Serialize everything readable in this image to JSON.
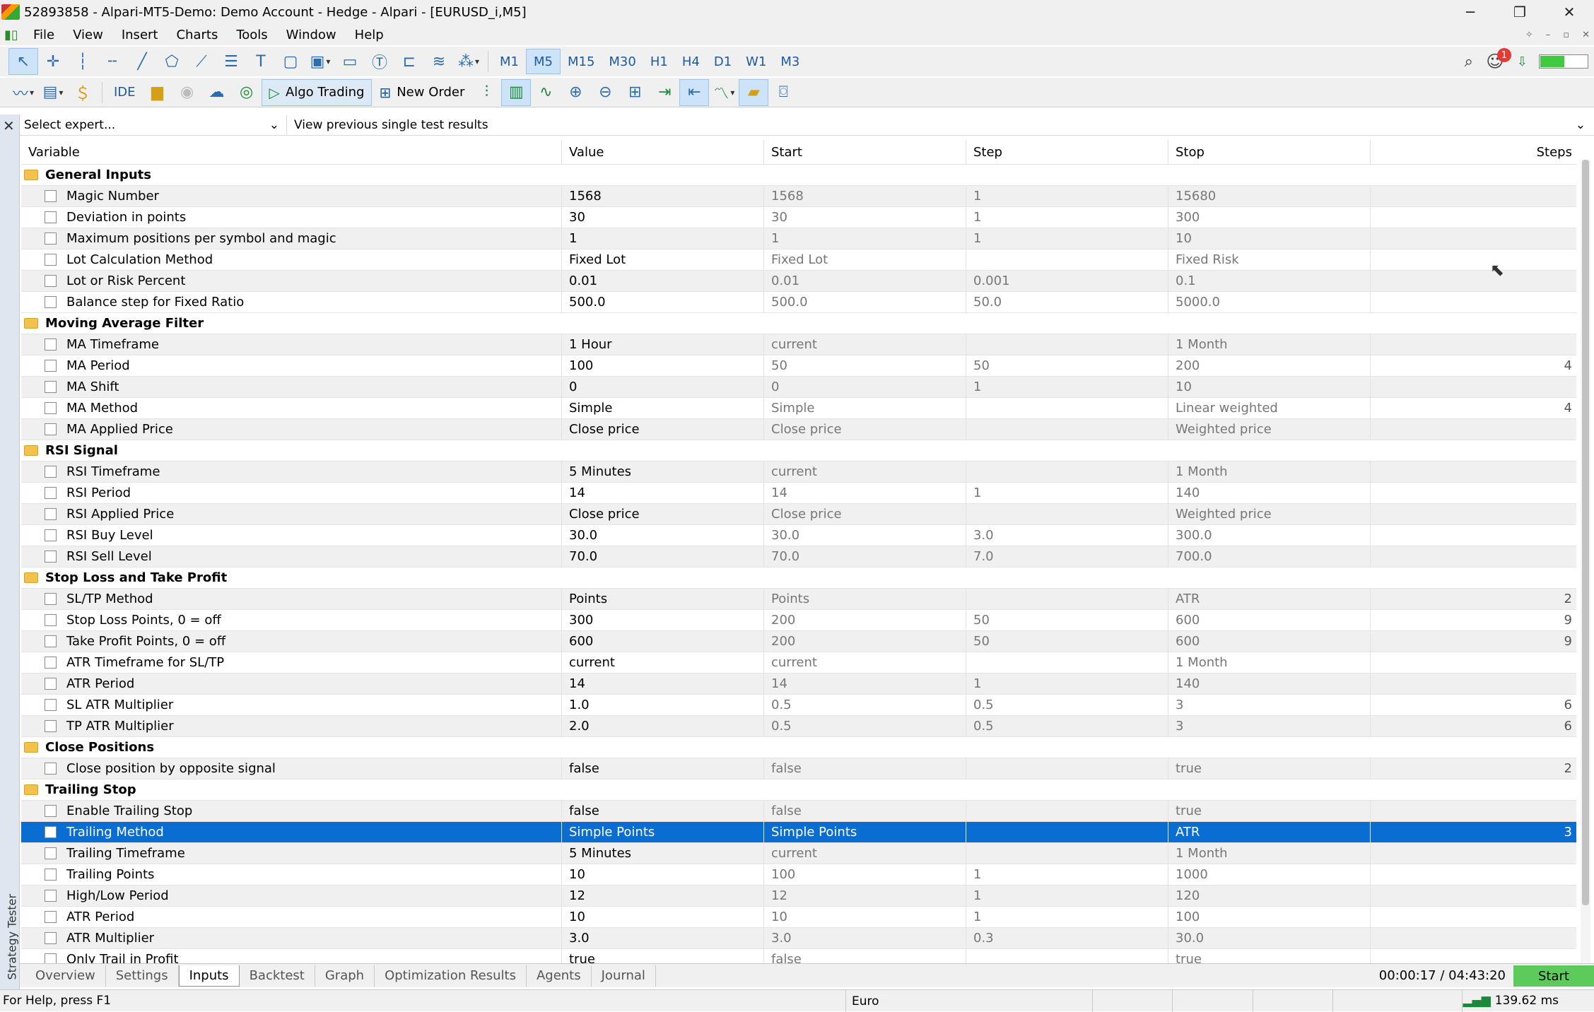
{
  "window": {
    "title": "52893858 - Alpari-MT5-Demo: Demo Account - Hedge - Alpari - [EURUSD_i,M5]"
  },
  "menu": [
    "File",
    "View",
    "Insert",
    "Charts",
    "Tools",
    "Window",
    "Help"
  ],
  "timeframes": [
    "M1",
    "M5",
    "M15",
    "M30",
    "H1",
    "H4",
    "D1",
    "W1",
    "M3"
  ],
  "timeframe_active": "M5",
  "toolbar2": {
    "ide": "IDE",
    "algo_trading": "Algo Trading",
    "new_order": "New Order"
  },
  "notifications": {
    "count": "1"
  },
  "expert": {
    "placeholder": "Select expert...",
    "view_previous": "View previous single test results"
  },
  "columns": [
    "Variable",
    "Value",
    "Start",
    "Step",
    "Stop",
    "Steps"
  ],
  "rows": [
    {
      "type": "group",
      "name": "General Inputs"
    },
    {
      "type": "param",
      "name": "Magic Number",
      "value": "1568",
      "start": "1568",
      "step": "1",
      "stop": "15680",
      "steps": ""
    },
    {
      "type": "param",
      "name": "Deviation in points",
      "value": "30",
      "start": "30",
      "step": "1",
      "stop": "300",
      "steps": ""
    },
    {
      "type": "param",
      "name": "Maximum positions per symbol and magic",
      "value": "1",
      "start": "1",
      "step": "1",
      "stop": "10",
      "steps": ""
    },
    {
      "type": "param",
      "name": "Lot Calculation Method",
      "value": "Fixed Lot",
      "start": "Fixed Lot",
      "step": "",
      "stop": "Fixed Risk",
      "steps": ""
    },
    {
      "type": "param",
      "name": "Lot or Risk Percent",
      "value": "0.01",
      "start": "0.01",
      "step": "0.001",
      "stop": "0.1",
      "steps": ""
    },
    {
      "type": "param",
      "name": "Balance step for Fixed Ratio",
      "value": "500.0",
      "start": "500.0",
      "step": "50.0",
      "stop": "5000.0",
      "steps": ""
    },
    {
      "type": "group",
      "name": "Moving Average Filter"
    },
    {
      "type": "param",
      "name": "MA Timeframe",
      "value": "1 Hour",
      "start": "current",
      "step": "",
      "stop": "1 Month",
      "steps": ""
    },
    {
      "type": "param",
      "name": "MA Period",
      "value": "100",
      "start": "50",
      "step": "50",
      "stop": "200",
      "steps": "4"
    },
    {
      "type": "param",
      "name": "MA Shift",
      "value": "0",
      "start": "0",
      "step": "1",
      "stop": "10",
      "steps": ""
    },
    {
      "type": "param",
      "name": "MA Method",
      "value": "Simple",
      "start": "Simple",
      "step": "",
      "stop": "Linear weighted",
      "steps": "4"
    },
    {
      "type": "param",
      "name": "MA Applied Price",
      "value": "Close price",
      "start": "Close price",
      "step": "",
      "stop": "Weighted price",
      "steps": ""
    },
    {
      "type": "group",
      "name": "RSI Signal"
    },
    {
      "type": "param",
      "name": "RSI Timeframe",
      "value": "5 Minutes",
      "start": "current",
      "step": "",
      "stop": "1 Month",
      "steps": ""
    },
    {
      "type": "param",
      "name": "RSI Period",
      "value": "14",
      "start": "14",
      "step": "1",
      "stop": "140",
      "steps": ""
    },
    {
      "type": "param",
      "name": "RSI Applied Price",
      "value": "Close price",
      "start": "Close price",
      "step": "",
      "stop": "Weighted price",
      "steps": ""
    },
    {
      "type": "param",
      "name": "RSI Buy Level",
      "value": "30.0",
      "start": "30.0",
      "step": "3.0",
      "stop": "300.0",
      "steps": ""
    },
    {
      "type": "param",
      "name": "RSI Sell Level",
      "value": "70.0",
      "start": "70.0",
      "step": "7.0",
      "stop": "700.0",
      "steps": ""
    },
    {
      "type": "group",
      "name": "Stop Loss and Take Profit"
    },
    {
      "type": "param",
      "name": "SL/TP Method",
      "value": "Points",
      "start": "Points",
      "step": "",
      "stop": "ATR",
      "steps": "2"
    },
    {
      "type": "param",
      "name": "Stop Loss Points, 0 = off",
      "value": "300",
      "start": "200",
      "step": "50",
      "stop": "600",
      "steps": "9"
    },
    {
      "type": "param",
      "name": "Take Profit Points, 0 = off",
      "value": "600",
      "start": "200",
      "step": "50",
      "stop": "600",
      "steps": "9"
    },
    {
      "type": "param",
      "name": "ATR Timeframe for SL/TP",
      "value": "current",
      "start": "current",
      "step": "",
      "stop": "1 Month",
      "steps": ""
    },
    {
      "type": "param",
      "name": "ATR Period",
      "value": "14",
      "start": "14",
      "step": "1",
      "stop": "140",
      "steps": ""
    },
    {
      "type": "param",
      "name": "SL ATR Multiplier",
      "value": "1.0",
      "start": "0.5",
      "step": "0.5",
      "stop": "3",
      "steps": "6"
    },
    {
      "type": "param",
      "name": "TP ATR Multiplier",
      "value": "2.0",
      "start": "0.5",
      "step": "0.5",
      "stop": "3",
      "steps": "6"
    },
    {
      "type": "group",
      "name": "Close Positions"
    },
    {
      "type": "param",
      "name": "Close position by opposite signal",
      "value": "false",
      "start": "false",
      "step": "",
      "stop": "true",
      "steps": "2"
    },
    {
      "type": "group",
      "name": "Trailing Stop"
    },
    {
      "type": "param",
      "name": "Enable Trailing Stop",
      "value": "false",
      "start": "false",
      "step": "",
      "stop": "true",
      "steps": ""
    },
    {
      "type": "param",
      "name": "Trailing Method",
      "value": "Simple Points",
      "start": "Simple Points",
      "step": "",
      "stop": "ATR",
      "steps": "3",
      "selected": true
    },
    {
      "type": "param",
      "name": "Trailing Timeframe",
      "value": "5 Minutes",
      "start": "current",
      "step": "",
      "stop": "1 Month",
      "steps": ""
    },
    {
      "type": "param",
      "name": "Trailing Points",
      "value": "10",
      "start": "100",
      "step": "1",
      "stop": "1000",
      "steps": ""
    },
    {
      "type": "param",
      "name": "High/Low Period",
      "value": "12",
      "start": "12",
      "step": "1",
      "stop": "120",
      "steps": ""
    },
    {
      "type": "param",
      "name": "ATR Period",
      "value": "10",
      "start": "10",
      "step": "1",
      "stop": "100",
      "steps": ""
    },
    {
      "type": "param",
      "name": "ATR Multiplier",
      "value": "3.0",
      "start": "3.0",
      "step": "0.3",
      "stop": "30.0",
      "steps": ""
    },
    {
      "type": "param",
      "name": "Only Trail in Profit",
      "value": "true",
      "start": "false",
      "step": "",
      "stop": "true",
      "steps": ""
    }
  ],
  "bottom_tabs": [
    "Overview",
    "Settings",
    "Inputs",
    "Backtest",
    "Graph",
    "Optimization Results",
    "Agents",
    "Journal"
  ],
  "bottom_tab_active": "Inputs",
  "timer": "00:00:17 / 04:43:20",
  "start_label": "Start",
  "side_tab": "Strategy Tester",
  "status": {
    "help": "For Help, press F1",
    "currency": "Euro",
    "ping": "139.62 ms"
  }
}
